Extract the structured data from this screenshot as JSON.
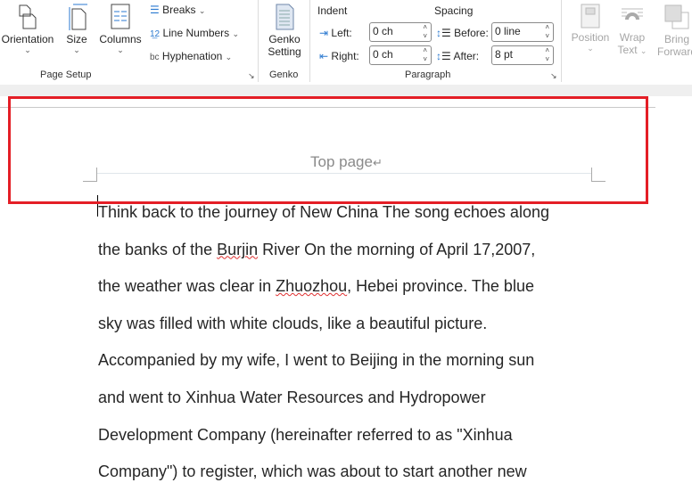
{
  "ribbon": {
    "page_setup": {
      "orientation": "Orientation",
      "size": "Size",
      "columns": "Columns",
      "breaks": "Breaks",
      "line_numbers": "Line Numbers",
      "hyphenation": "Hyphenation",
      "group_label": "Page Setup"
    },
    "genko": {
      "setting_line1": "Genko",
      "setting_line2": "Setting",
      "group_label": "Genko"
    },
    "paragraph": {
      "indent": "Indent",
      "spacing": "Spacing",
      "left_label": "Left:",
      "right_label": "Right:",
      "before_label": "Before:",
      "after_label": "After:",
      "left_value": "0 ch",
      "right_value": "0 ch",
      "before_value": "0 line",
      "after_value": "8 pt",
      "group_label": "Paragraph"
    },
    "arrange": {
      "position": "Position",
      "wrap_line1": "Wrap",
      "wrap_line2": "Text",
      "bring_line1": "Bring",
      "bring_line2": "Forward"
    }
  },
  "document": {
    "header_text": "Top page",
    "paragraph_mark": "↵",
    "lines": [
      [
        "Think back to the journey of New China The song echoes along"
      ],
      [
        "the banks of the ",
        "Burjin",
        " River On the morning of April 17,2007,"
      ],
      [
        "the weather was clear in ",
        "Zhuozhou",
        ", Hebei province. The blue"
      ],
      [
        "sky was filled with white clouds, like a beautiful picture."
      ],
      [
        "Accompanied by my wife, I went to Beijing in the morning sun"
      ],
      [
        "and went to Xinhua Water Resources and Hydropower"
      ],
      [
        "Development Company (hereinafter referred to as \"Xinhua"
      ],
      [
        "Company\") to register, which was about to start another new"
      ]
    ]
  },
  "colors": {
    "highlight": "#e41e26",
    "accent": "#2b79d0"
  }
}
